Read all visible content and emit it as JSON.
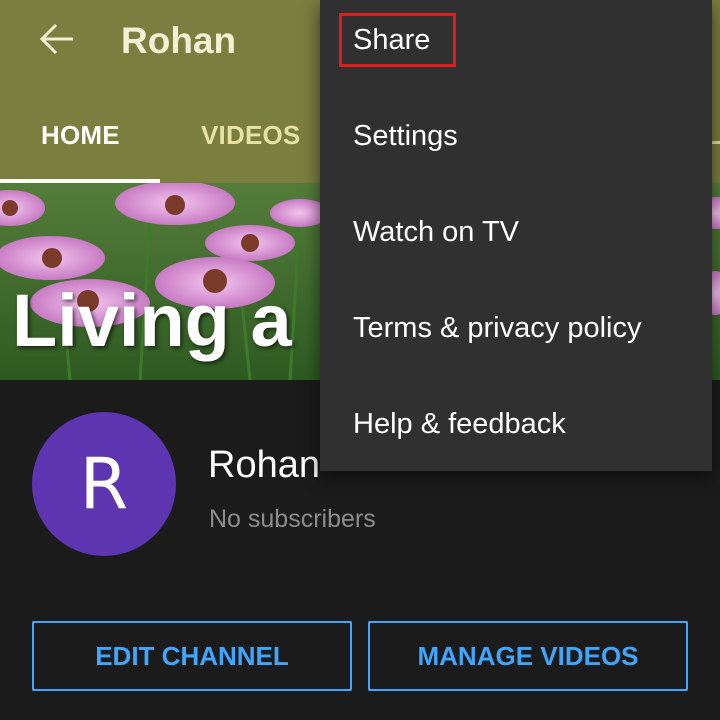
{
  "header": {
    "title": "Rohan",
    "back_icon": "arrow-left-icon"
  },
  "tabs": [
    {
      "label": "HOME",
      "active": true
    },
    {
      "label": "VIDEOS",
      "active": false
    },
    {
      "label": "L",
      "active": false
    }
  ],
  "banner": {
    "text": "Living a"
  },
  "channel": {
    "avatar_letter": "R",
    "avatar_color": "#5e35b1",
    "name": "Rohan",
    "subscribers": "No subscribers"
  },
  "actions": {
    "edit_label": "EDIT CHANNEL",
    "manage_label": "MANAGE VIDEOS"
  },
  "menu": {
    "items": [
      "Share",
      "Settings",
      "Watch on TV",
      "Terms & privacy policy",
      "Help & feedback"
    ],
    "highlighted": "Share",
    "highlight_color": "#e01b1b"
  },
  "colors": {
    "appbar": "#7a7e3f",
    "accent": "#3ea6ff",
    "menu_bg": "#303030",
    "page_bg": "#1b1b1b"
  }
}
